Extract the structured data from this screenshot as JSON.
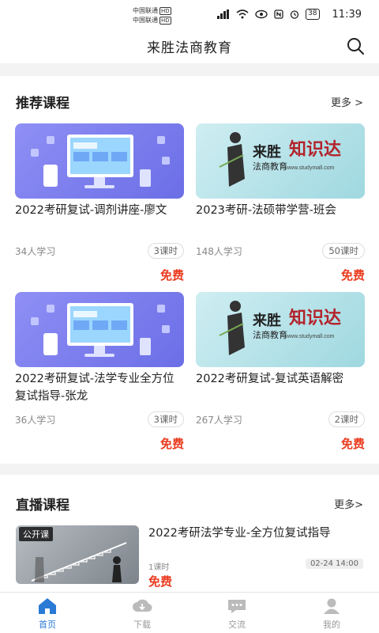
{
  "status_bar": {
    "carrier1": "中国联通",
    "carrier2": "中国联通",
    "hd": "HD",
    "battery": "38",
    "time": "11:39"
  },
  "header": {
    "title": "来胜法商教育",
    "search_icon": "search-icon"
  },
  "recommended": {
    "title": "推荐课程",
    "more": "更多 >",
    "courses": [
      {
        "title": "2022考研复试-调剂讲座-廖文",
        "learners": "34人学习",
        "lessons": "3课时",
        "price": "免费",
        "thumb": "purple"
      },
      {
        "title": "2023考研-法硕带学营-班会",
        "learners": "148人学习",
        "lessons": "50课时",
        "price": "免费",
        "thumb": "teal"
      },
      {
        "title": "2022考研复试-法学专业全方位复试指导-张龙",
        "learners": "36人学习",
        "lessons": "3课时",
        "price": "免费",
        "thumb": "purple"
      },
      {
        "title": "2022考研复试-复试英语解密",
        "learners": "267人学习",
        "lessons": "2课时",
        "price": "免费",
        "thumb": "teal"
      }
    ],
    "brand_text": "来胜",
    "brand_sub": "法商教育",
    "brand_headline": "知识达",
    "brand_url": "www.studymall.com"
  },
  "live": {
    "title": "直播课程",
    "more": "更多>",
    "item": {
      "tag": "公开课",
      "title": "2022考研法学专业-全方位复试指导",
      "lessons": "1课时",
      "time": "02-24 14:00",
      "price": "免费"
    }
  },
  "tabs": [
    {
      "label": "首页",
      "icon": "home-icon",
      "active": true
    },
    {
      "label": "下载",
      "icon": "download-icon",
      "active": false
    },
    {
      "label": "交流",
      "icon": "chat-icon",
      "active": false
    },
    {
      "label": "我的",
      "icon": "user-icon",
      "active": false
    }
  ],
  "colors": {
    "accent": "#2a7ad6",
    "price": "#ea3b1f"
  }
}
